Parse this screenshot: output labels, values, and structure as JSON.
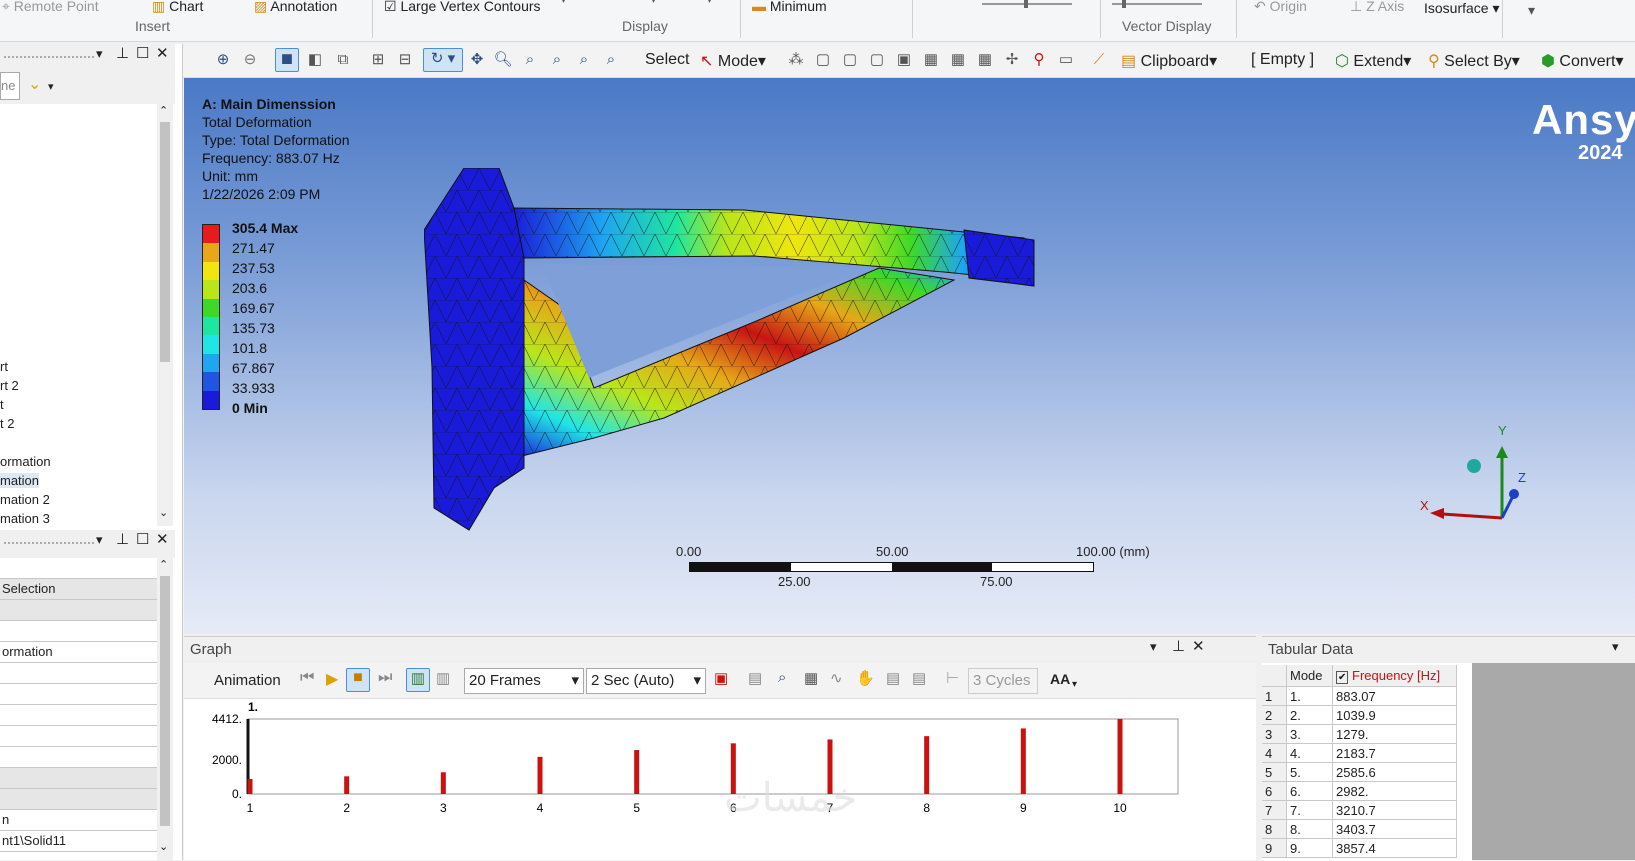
{
  "ribbon": {
    "remote_point": "Remote Point",
    "chart": "Chart",
    "annotation": "Annotation",
    "insert_group": "Insert",
    "large_vertex_contours": "Large Vertex Contours",
    "display_group": "Display",
    "minimum": "Minimum",
    "vector_display_group": "Vector Display",
    "origin": "Origin",
    "z_axis": "Z Axis",
    "isosurface": "Isosurface"
  },
  "toolbar": {
    "select": "Select",
    "mode": "Mode",
    "clipboard": "Clipboard",
    "empty": "[ Empty ]",
    "extend": "Extend",
    "select_by": "Select By",
    "convert": "Convert"
  },
  "left_tree": {
    "filter_text": "ne",
    "items": [
      "rt",
      "rt 2",
      "t",
      "t 2",
      "ormation",
      "mation",
      "mation 2",
      "mation 3"
    ]
  },
  "details": {
    "rows": [
      "",
      "Selection",
      "",
      "",
      "ormation",
      "",
      "",
      "",
      "",
      "",
      "",
      "",
      "n",
      "nt1\\Solid11"
    ]
  },
  "viewport": {
    "title": "A: Main Dimenssion",
    "result": "Total Deformation",
    "type": "Type: Total Deformation",
    "frequency": "Frequency: 883.07 Hz",
    "unit": "Unit: mm",
    "date": "1/22/2026 2:09 PM",
    "legend": [
      "305.4 Max",
      "271.47",
      "237.53",
      "203.6",
      "169.67",
      "135.73",
      "101.8",
      "67.867",
      "33.933",
      "0 Min"
    ],
    "legend_colors": [
      "#e81a1a",
      "#e6a817",
      "#f0e60e",
      "#b9e619",
      "#3ed928",
      "#1ee6a0",
      "#1ee6e6",
      "#1ea6f0",
      "#1f55e0",
      "#1a1ad9"
    ],
    "brand": "Ansy",
    "version": "2024",
    "scale_labels_top": [
      "0.00",
      "50.00",
      "100.00 (mm)"
    ],
    "scale_labels_bottom": [
      "25.00",
      "75.00"
    ],
    "axis_x": "X",
    "axis_y": "Y",
    "axis_z": "Z"
  },
  "graph": {
    "title": "Graph",
    "animation": "Animation",
    "frames": "20 Frames",
    "duration": "2 Sec (Auto)",
    "cycles": "3 Cycles",
    "aa": "AA",
    "marker": "1."
  },
  "chart_data": {
    "type": "bar",
    "categories": [
      "1",
      "2",
      "3",
      "4",
      "5",
      "6",
      "7",
      "8",
      "9",
      "10"
    ],
    "values": [
      883.07,
      1039.9,
      1279,
      2183.7,
      2585.6,
      2982,
      3210.7,
      3403.7,
      3857.4,
      4412
    ],
    "y_ticks": [
      "4412.",
      "2000.",
      "0."
    ],
    "ylim": [
      0,
      4412
    ],
    "bar_color": "#cc1111"
  },
  "tabular": {
    "title": "Tabular Data",
    "col_mode": "Mode",
    "col_freq": "Frequency [Hz]",
    "rows": [
      [
        "1",
        "1.",
        "883.07"
      ],
      [
        "2",
        "2.",
        "1039.9"
      ],
      [
        "3",
        "3.",
        "1279."
      ],
      [
        "4",
        "4.",
        "2183.7"
      ],
      [
        "5",
        "5.",
        "2585.6"
      ],
      [
        "6",
        "6.",
        "2982."
      ],
      [
        "7",
        "7.",
        "3210.7"
      ],
      [
        "8",
        "8.",
        "3403.7"
      ],
      [
        "9",
        "9.",
        "3857.4"
      ]
    ]
  }
}
